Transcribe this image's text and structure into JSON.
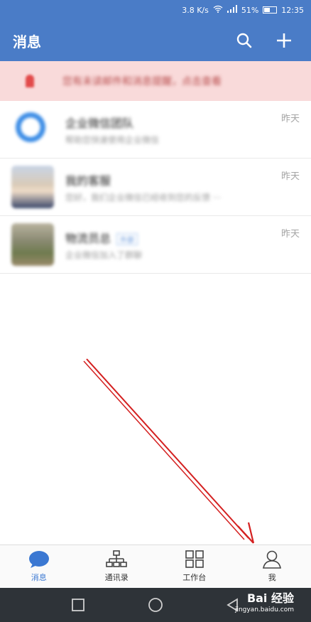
{
  "status_bar": {
    "speed": "3.8 K/s",
    "battery_pct": "51%",
    "time": "12:35"
  },
  "header": {
    "title": "消息"
  },
  "notice": {
    "text": "您有未读邮件和消息提醒，点击查看"
  },
  "conversations": [
    {
      "name": "企业微信团队",
      "preview": "帮助您快速使用企业微信",
      "time": "昨天",
      "tag": "",
      "avatar": "app-logo"
    },
    {
      "name": "我的客服",
      "preview": "您好，我们企业微信已经收到您的反馈 ···",
      "time": "昨天",
      "tag": "",
      "avatar": "person-photo"
    },
    {
      "name": "物流员总",
      "preview": "企业微信加入了群聊",
      "time": "昨天",
      "tag": "外部",
      "avatar": "group-photo"
    }
  ],
  "bottom_nav": [
    {
      "label": "消息",
      "icon": "chat-bubble-icon",
      "active": true
    },
    {
      "label": "通讯录",
      "icon": "org-chart-icon",
      "active": false
    },
    {
      "label": "工作台",
      "icon": "grid-icon",
      "active": false
    },
    {
      "label": "我",
      "icon": "person-icon",
      "active": false
    }
  ],
  "watermark": {
    "brand": "Bai 经验",
    "url": "jingyan.baidu.com"
  },
  "colors": {
    "brand_blue": "#4a7cc7",
    "notice_bg": "#f9dada",
    "annotation_red": "#d42020"
  }
}
